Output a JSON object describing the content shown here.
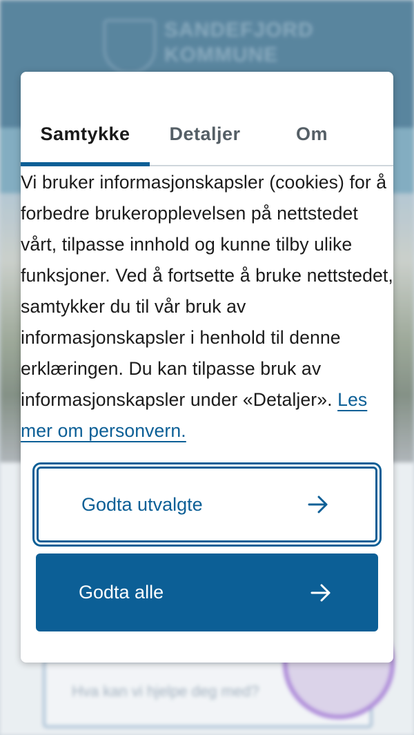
{
  "background": {
    "brand_line1": "SANDEFJORD",
    "brand_line2": "KOMMUNE",
    "search_placeholder": "Hva kan vi hjelpe deg med?"
  },
  "dialog": {
    "tabs": [
      {
        "label": "Samtykke",
        "active": true
      },
      {
        "label": "Detaljer",
        "active": false
      },
      {
        "label": "Om",
        "active": false
      }
    ],
    "body": "Vi bruker informasjonskapsler (cookies) for å forbedre brukeropplevelsen på nettstedet vårt, tilpasse innhold og kunne tilby ulike funksjoner. Ved å fortsette å bruke nettstedet, samtykker du til vår bruk av informasjonskapsler i henhold til denne erklæringen. Du kan tilpasse bruk av informasjonskapsler under «Detaljer».",
    "link": "Les mer om personvern.",
    "buttons": {
      "accept_selected": "Godta utvalgte",
      "accept_all": "Godta alle"
    }
  },
  "colors": {
    "accent": "#0c5f96",
    "text": "#1b1b1b",
    "tab_inactive": "#555f66"
  },
  "icons": {
    "button_arrow": "arrow-right-icon"
  }
}
